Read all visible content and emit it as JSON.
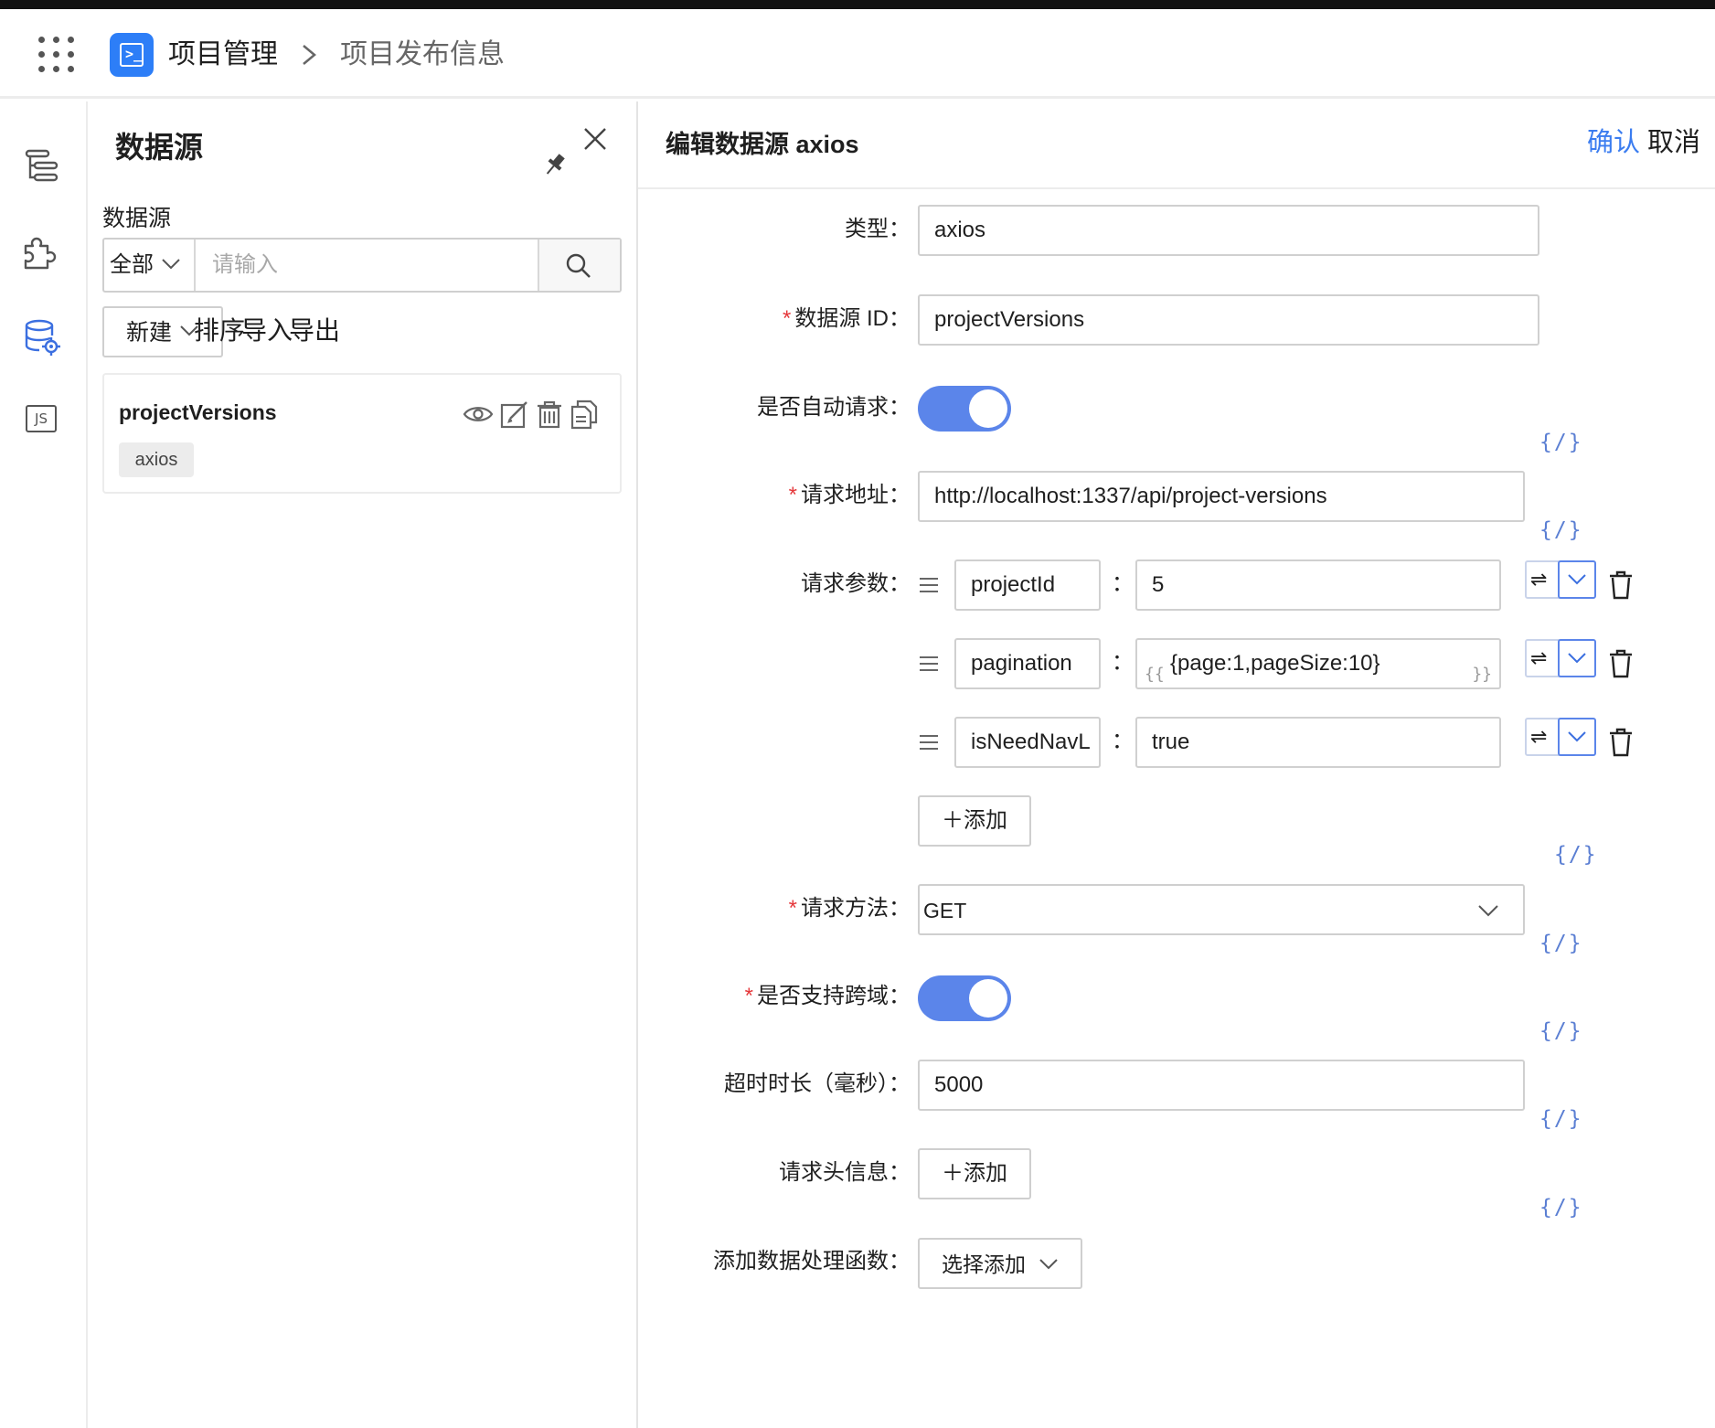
{
  "header": {
    "app_name": "项目管理",
    "page_name": "项目发布信息"
  },
  "rail": {
    "items": [
      "outline-icon",
      "component-icon",
      "datasource-icon",
      "js-icon"
    ],
    "active": "datasource-icon",
    "js_label": "JS"
  },
  "panel": {
    "title": "数据源",
    "filter_label": "数据源",
    "filter_select": "全部",
    "search_placeholder": "请输入",
    "new_label": "新建",
    "sort_label": "排序",
    "import_label": "导入",
    "export_label": "导出",
    "items": [
      {
        "name": "projectVersions",
        "tag": "axios"
      }
    ]
  },
  "editor": {
    "title": "编辑数据源 axios",
    "confirm_label": "确认",
    "cancel_label": "取消",
    "code_toggle_label": "{/}",
    "fields": {
      "type_label": "类型：",
      "type_value": "axios",
      "id_label": "数据源 ID：",
      "id_value": "projectVersions",
      "auto_label": "是否自动请求：",
      "auto_on": true,
      "url_label": "请求地址：",
      "url_value": "http://localhost:1337/api/project-versions",
      "params_label": "请求参数：",
      "params": [
        {
          "key": "projectId",
          "value": "5",
          "expression": false
        },
        {
          "key": "pagination",
          "value": "{page:1,pageSize:10}",
          "expression": true
        },
        {
          "key": "isNeedNavL",
          "value": "true",
          "expression": false
        }
      ],
      "param_colon": "：",
      "expr_open": "{{",
      "expr_close": "}}",
      "swap_symbol": "⇌",
      "add_label": "＋添加",
      "method_label": "请求方法：",
      "method_value": "GET",
      "cors_label": "是否支持跨域：",
      "cors_on": true,
      "timeout_label": "超时时长（毫秒）：",
      "timeout_value": "5000",
      "headers_label": "请求头信息：",
      "headers_add_label": "＋添加",
      "handler_label": "添加数据处理函数：",
      "handler_select": "选择添加"
    }
  },
  "colors": {
    "accent": "#5b85ea",
    "link": "#3b7df0",
    "required": "#e5383b",
    "logo": "#2d7ef7"
  }
}
